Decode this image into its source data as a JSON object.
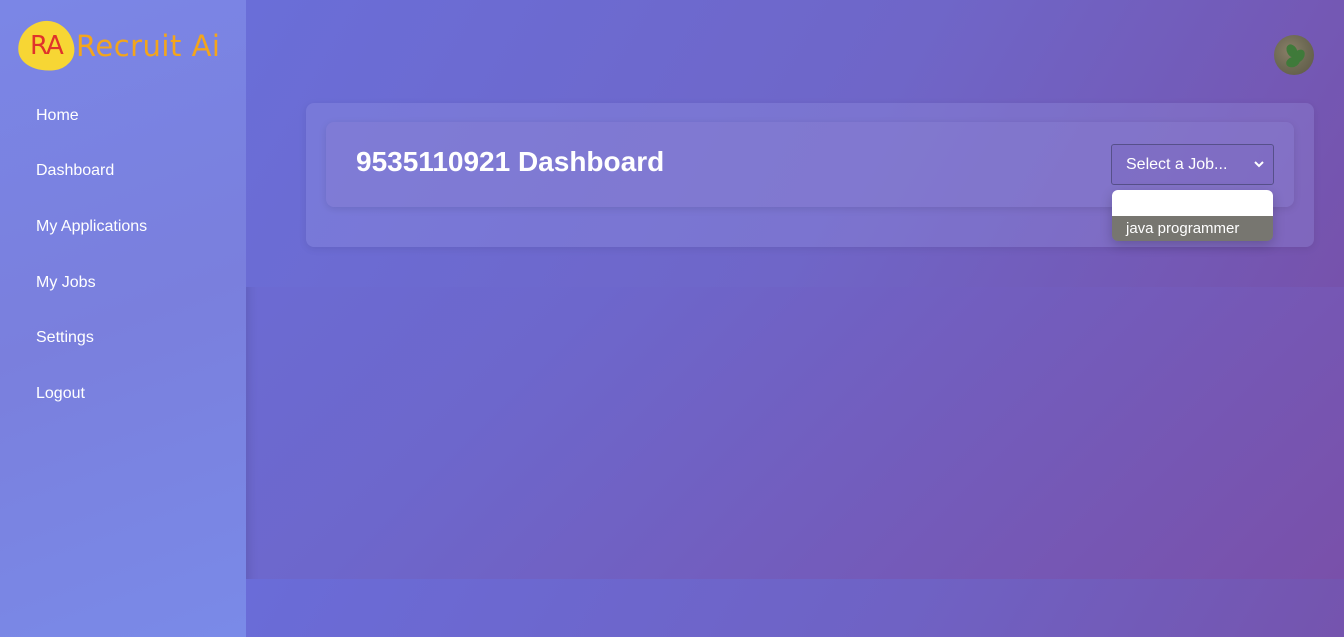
{
  "brand": {
    "logo_mark": "RA",
    "name": "Recruit Ai"
  },
  "sidebar": {
    "items": [
      {
        "label": "Home"
      },
      {
        "label": "Dashboard"
      },
      {
        "label": "My Applications"
      },
      {
        "label": "My Jobs"
      },
      {
        "label": "Settings"
      },
      {
        "label": "Logout"
      }
    ]
  },
  "header": {
    "avatar_icon": "user-avatar"
  },
  "dashboard": {
    "title": "9535110921 Dashboard",
    "job_select": {
      "selected_label": "Select a Job...",
      "options": [
        "",
        "java programmer"
      ]
    }
  },
  "colors": {
    "logo_yellow": "#f7d634",
    "logo_red": "#e0332b",
    "logo_orange": "#f3a51c",
    "highlighted_option": "#777670"
  }
}
